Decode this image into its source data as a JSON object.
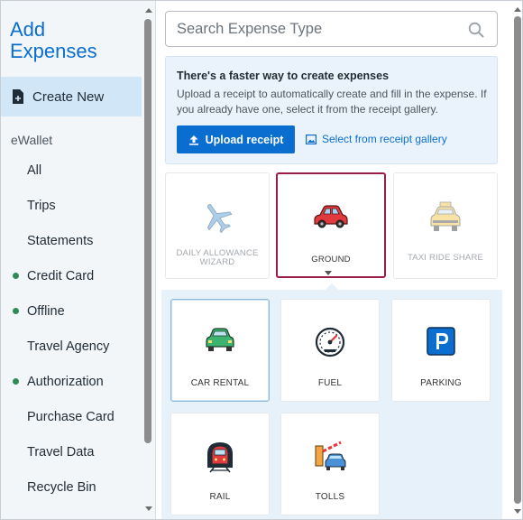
{
  "sidebar": {
    "title": "Add Expenses",
    "create_new": "Create New",
    "section": "eWallet",
    "items": [
      {
        "label": "All",
        "dot": false
      },
      {
        "label": "Trips",
        "dot": false
      },
      {
        "label": "Statements",
        "dot": false
      },
      {
        "label": "Credit Card",
        "dot": true
      },
      {
        "label": "Offline",
        "dot": true
      },
      {
        "label": "Travel Agency",
        "dot": false
      },
      {
        "label": "Authorization",
        "dot": true
      },
      {
        "label": "Purchase Card",
        "dot": false
      },
      {
        "label": "Travel Data",
        "dot": false
      },
      {
        "label": "Recycle Bin",
        "dot": false
      }
    ]
  },
  "search": {
    "placeholder": "Search Expense Type",
    "value": ""
  },
  "promo": {
    "title": "There's a faster way to create expenses",
    "text": "Upload a receipt to automatically create and fill in the expense. If you already have one, select it from the receipt gallery.",
    "upload_label": "Upload receipt",
    "gallery_label": "Select from receipt gallery"
  },
  "categories": [
    {
      "label": "DAILY ALLOWANCE WIZARD",
      "icon": "airplane-icon",
      "state": "disabled"
    },
    {
      "label": "GROUND",
      "icon": "car-icon",
      "state": "selected"
    },
    {
      "label": "TAXI RIDE SHARE",
      "icon": "taxi-icon",
      "state": "disabled"
    }
  ],
  "subcategories": [
    {
      "label": "CAR RENTAL",
      "icon": "car-rental-icon"
    },
    {
      "label": "FUEL",
      "icon": "fuel-gauge-icon"
    },
    {
      "label": "PARKING",
      "icon": "parking-icon"
    },
    {
      "label": "RAIL",
      "icon": "train-icon"
    },
    {
      "label": "TOLLS",
      "icon": "toll-gate-icon"
    }
  ],
  "colors": {
    "accent": "#0a6ed1",
    "selected_border": "#9a1d47",
    "status_dot": "#2e8b57",
    "nav_active_bg": "#d1e6f6",
    "subpanel_bg": "#e7f1fa"
  }
}
